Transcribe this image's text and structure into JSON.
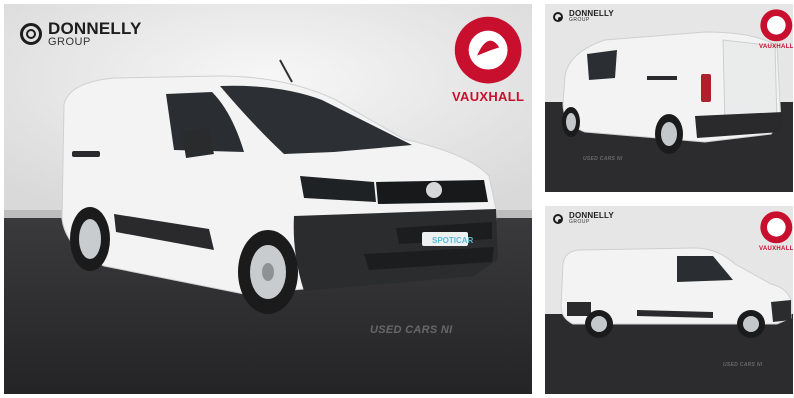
{
  "gallery": {
    "dealer_name": "DONNELLY",
    "dealer_group": "GROUP",
    "brand_name": "VAUXHALL",
    "badge_text": "SPOTICAR",
    "watermark": "USED CARS NI"
  },
  "images": [
    {
      "view": "front three-quarter"
    },
    {
      "view": "rear three-quarter"
    },
    {
      "view": "side profile"
    }
  ],
  "colors": {
    "paint": "#f2f3f2",
    "studio_wall": "#ececec",
    "floor": "#2b2b2d",
    "brand_red": "#c8102e"
  },
  "icons": [
    "donnelly-logo-icon",
    "vauxhall-griffin-icon"
  ]
}
